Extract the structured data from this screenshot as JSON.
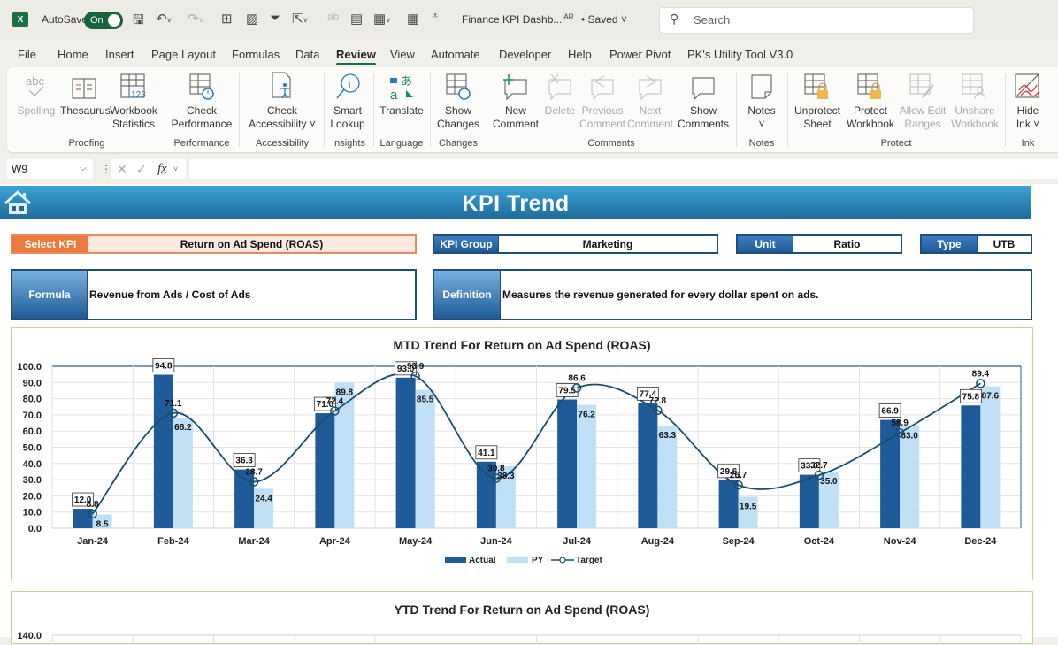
{
  "app": {
    "logo": "X",
    "autosave_label": "AutoSave",
    "autosave_state": "On",
    "doc_title": "Finance KPI Dashb...",
    "save_status": "• Saved",
    "search_placeholder": "Search"
  },
  "quick_access": [
    "save-icon",
    "undo-icon",
    "redo-icon",
    "borders-icon",
    "picture-icon",
    "filter-icon",
    "share-icon",
    "spelling-icon",
    "form-icon",
    "calculator-icon",
    "calculator2-icon",
    "customize-icon"
  ],
  "menu_tabs": [
    "File",
    "Home",
    "Insert",
    "Page Layout",
    "Formulas",
    "Data",
    "Review",
    "View",
    "Automate",
    "Developer",
    "Help",
    "Power Pivot",
    "PK's Utility Tool V3.0"
  ],
  "active_tab": "Review",
  "ribbon": {
    "buttons": [
      {
        "label": "Spelling",
        "label2": "",
        "icon": "spelling-icon",
        "disabled": true
      },
      {
        "label": "Thesaurus",
        "label2": "",
        "icon": "thesaurus-icon",
        "disabled": false
      },
      {
        "label": "Workbook",
        "label2": "Statistics",
        "icon": "workbook-statistics-icon",
        "disabled": false
      },
      {
        "label": "Check",
        "label2": "Performance",
        "icon": "check-performance-icon",
        "disabled": false
      },
      {
        "label": "Check",
        "label2": "Accessibility ˅",
        "icon": "check-accessibility-icon",
        "disabled": false
      },
      {
        "label": "Smart",
        "label2": "Lookup",
        "icon": "smart-lookup-icon",
        "disabled": false
      },
      {
        "label": "Translate",
        "label2": "",
        "icon": "translate-icon",
        "disabled": false
      },
      {
        "label": "Show",
        "label2": "Changes",
        "icon": "show-changes-icon",
        "disabled": false
      },
      {
        "label": "New",
        "label2": "Comment",
        "icon": "new-comment-icon",
        "disabled": false
      },
      {
        "label": "Delete",
        "label2": "",
        "icon": "delete-comment-icon",
        "disabled": true
      },
      {
        "label": "Previous",
        "label2": "Comment",
        "icon": "previous-comment-icon",
        "disabled": true
      },
      {
        "label": "Next",
        "label2": "Comment",
        "icon": "next-comment-icon",
        "disabled": true
      },
      {
        "label": "Show",
        "label2": "Comments",
        "icon": "show-comments-icon",
        "disabled": false
      },
      {
        "label": "Notes",
        "label2": "˅",
        "icon": "notes-icon",
        "disabled": false
      },
      {
        "label": "Unprotect",
        "label2": "Sheet",
        "icon": "unprotect-sheet-icon",
        "disabled": false
      },
      {
        "label": "Protect",
        "label2": "Workbook",
        "icon": "protect-workbook-icon",
        "disabled": false
      },
      {
        "label": "Allow Edit",
        "label2": "Ranges",
        "icon": "allow-edit-ranges-icon",
        "disabled": true
      },
      {
        "label": "Unshare",
        "label2": "Workbook",
        "icon": "unshare-workbook-icon",
        "disabled": true
      },
      {
        "label": "Hide",
        "label2": "Ink ˅",
        "icon": "hide-ink-icon",
        "disabled": false
      }
    ],
    "groups": [
      "Proofing",
      "Performance",
      "Accessibility",
      "Insights",
      "Language",
      "Changes",
      "Comments",
      "Notes",
      "Protect",
      "Ink"
    ]
  },
  "formula_bar": {
    "name_box": "W9",
    "fx": "fx",
    "formula": ""
  },
  "dashboard": {
    "title": "KPI Trend",
    "select_kpi_label": "Select KPI",
    "select_kpi_value": "Return on Ad Spend (ROAS)",
    "kpi_group_label": "KPI Group",
    "kpi_group_value": "Marketing",
    "unit_label": "Unit",
    "unit_value": "Ratio",
    "type_label": "Type",
    "type_value": "UTB",
    "formula_label": "Formula",
    "formula_value": "Revenue from Ads / Cost of Ads",
    "definition_label": "Definition",
    "definition_value": "Measures the revenue generated for every dollar spent on ads."
  },
  "colors": {
    "actual": "#1f5b99",
    "py": "#bfe0f5",
    "target": "#1a4d6e",
    "accent_orange": "#ec7a3c",
    "banner": "#1d6a9a"
  },
  "chart_data": [
    {
      "type": "bar",
      "title": "MTD Trend For Return on Ad Spend (ROAS)",
      "categories": [
        "Jan-24",
        "Feb-24",
        "Mar-24",
        "Apr-24",
        "May-24",
        "Jun-24",
        "Jul-24",
        "Aug-24",
        "Sep-24",
        "Oct-24",
        "Nov-24",
        "Dec-24"
      ],
      "series": [
        {
          "name": "Actual",
          "kind": "bar",
          "values": [
            12.0,
            94.8,
            36.3,
            71.0,
            93.0,
            41.1,
            79.5,
            77.4,
            29.6,
            33.0,
            66.9,
            75.8
          ]
        },
        {
          "name": "PY",
          "kind": "bar",
          "values": [
            8.5,
            68.2,
            24.4,
            89.8,
            85.5,
            38.3,
            76.2,
            63.3,
            19.5,
            35.0,
            63.0,
            87.6
          ]
        },
        {
          "name": "Target",
          "kind": "line",
          "values": [
            8.8,
            71.1,
            28.7,
            72.4,
            93.9,
            30.8,
            86.6,
            72.8,
            26.7,
            32.7,
            58.9,
            89.4
          ]
        }
      ],
      "yticks": [
        "100.0",
        "90.0",
        "80.0",
        "70.0",
        "60.0",
        "50.0",
        "40.0",
        "30.0",
        "20.0",
        "10.0",
        "0.0"
      ],
      "ylim": [
        0,
        100
      ],
      "xlabel": "",
      "ylabel": "",
      "grid": true,
      "legend": "bottom"
    },
    {
      "type": "bar",
      "title": "YTD Trend For Return on Ad Spend (ROAS)",
      "yticks": [
        "140.0"
      ],
      "ylim": [
        0,
        140
      ],
      "grid": true
    }
  ]
}
